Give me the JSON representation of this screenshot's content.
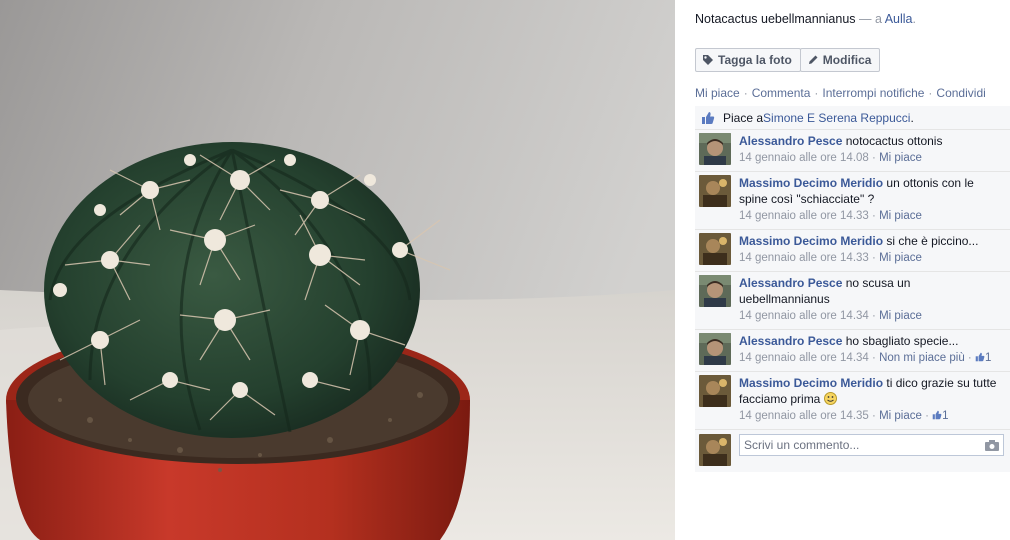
{
  "photo": {
    "alt": "cactus"
  },
  "post": {
    "title": "Notacactus uebellmannianus",
    "dash": " — a ",
    "location": "Aulla",
    "location_end": "."
  },
  "buttons": {
    "tag": "Tagga la foto",
    "edit": "Modifica"
  },
  "actions": [
    "Mi piace",
    "Commenta",
    "Interrompi notifiche",
    "Condividi"
  ],
  "likes": {
    "prefix": "Piace a ",
    "names": "Simone E Serena Reppucci",
    "suffix": "."
  },
  "comments": [
    {
      "author": "Alessandro Pesce",
      "text": "notocactus ottonis",
      "time": "14 gennaio alle ore 14.08",
      "like": "Mi piace",
      "likes": "",
      "avatar": "alessandro"
    },
    {
      "author": "Massimo Decimo Meridio",
      "text": "un ottonis con le spine così \"schiacciate\" ?",
      "time": "14 gennaio alle ore 14.33",
      "like": "Mi piace",
      "likes": "",
      "avatar": "massimo"
    },
    {
      "author": "Massimo Decimo Meridio",
      "text": "si che è piccino...",
      "time": "14 gennaio alle ore 14.33",
      "like": "Mi piace",
      "likes": "",
      "avatar": "massimo"
    },
    {
      "author": "Alessandro Pesce",
      "text": "no scusa un uebellmannianus",
      "time": "14 gennaio alle ore 14.34",
      "like": "Mi piace",
      "likes": "",
      "avatar": "alessandro"
    },
    {
      "author": "Alessandro Pesce",
      "text": "ho sbagliato specie...",
      "time": "14 gennaio alle ore 14.34",
      "like": "Non mi piace più",
      "likes": "1",
      "avatar": "alessandro"
    },
    {
      "author": "Massimo Decimo Meridio",
      "text": "ti dico grazie su tutte facciamo prima",
      "time": "14 gennaio alle ore 14.35",
      "like": "Mi piace",
      "likes": "1",
      "avatar": "massimo",
      "emoji": true
    }
  ],
  "reply": {
    "placeholder": "Scrivi un commento..."
  },
  "separators": {
    "dot": "·"
  }
}
